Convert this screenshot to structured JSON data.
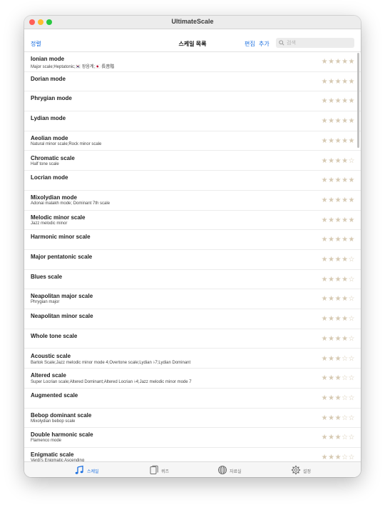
{
  "window": {
    "title": "UltimateScale"
  },
  "navbar": {
    "sort_label": "정렬",
    "title": "스케일 목록",
    "edit_label": "편집",
    "add_label": "추가",
    "search_placeholder": "검색"
  },
  "scales": [
    {
      "name": "Ionian mode",
      "aliases": "Major scale;Heptatonic;🇰🇷 장음계;🇯🇵 長音階",
      "rating": 5
    },
    {
      "name": "Dorian mode",
      "aliases": "",
      "rating": 5
    },
    {
      "name": "Phrygian mode",
      "aliases": "",
      "rating": 5
    },
    {
      "name": "Lydian mode",
      "aliases": "",
      "rating": 5
    },
    {
      "name": "Aeolian mode",
      "aliases": "Natural minor scale;Rock minor scale",
      "rating": 5
    },
    {
      "name": "Chromatic scale",
      "aliases": "Half tone scale",
      "rating": 4
    },
    {
      "name": "Locrian mode",
      "aliases": "",
      "rating": 5
    },
    {
      "name": "Mixolydian mode",
      "aliases": "Adonai malakh mode; Dominant 7th scale",
      "rating": 5
    },
    {
      "name": "Melodic minor scale",
      "aliases": "Jazz melodic minor",
      "rating": 5
    },
    {
      "name": "Harmonic minor scale",
      "aliases": "",
      "rating": 5
    },
    {
      "name": "Major pentatonic scale",
      "aliases": "",
      "rating": 4
    },
    {
      "name": "Blues scale",
      "aliases": "",
      "rating": 4
    },
    {
      "name": "Neapolitan major scale",
      "aliases": "Phrygian major",
      "rating": 4
    },
    {
      "name": "Neapolitan minor scale",
      "aliases": "",
      "rating": 4
    },
    {
      "name": "Whole tone scale",
      "aliases": "",
      "rating": 4
    },
    {
      "name": "Acoustic scale",
      "aliases": "Bartok Scale;Jazz melodic minor mode 4;Overtone scale;Lydian ♭7;Lydian Dominant",
      "rating": 3
    },
    {
      "name": "Altered scale",
      "aliases": "Super Locrian scale;Altered Dominant;Altered Locrian ♭4;Jazz melodic minor mode 7",
      "rating": 3
    },
    {
      "name": "Augmented scale",
      "aliases": "",
      "rating": 3
    },
    {
      "name": "Bebop dominant scale",
      "aliases": "Mixolydian bebop scale",
      "rating": 3
    },
    {
      "name": "Double harmonic scale",
      "aliases": "Flamenco mode",
      "rating": 3
    },
    {
      "name": "Enigmatic scale",
      "aliases": "Verdi's Enigmatic Ascending",
      "rating": 3
    }
  ],
  "rating_max": 5,
  "star_color": "#d7cab3",
  "accent_color": "#1b6fe0",
  "tabs": [
    {
      "label": "스케일",
      "icon": "music-notes-icon",
      "active": true
    },
    {
      "label": "퀴즈",
      "icon": "quiz-cards-icon",
      "active": false
    },
    {
      "label": "자료실",
      "icon": "globe-icon",
      "active": false
    },
    {
      "label": "설정",
      "icon": "gear-icon",
      "active": false
    }
  ]
}
